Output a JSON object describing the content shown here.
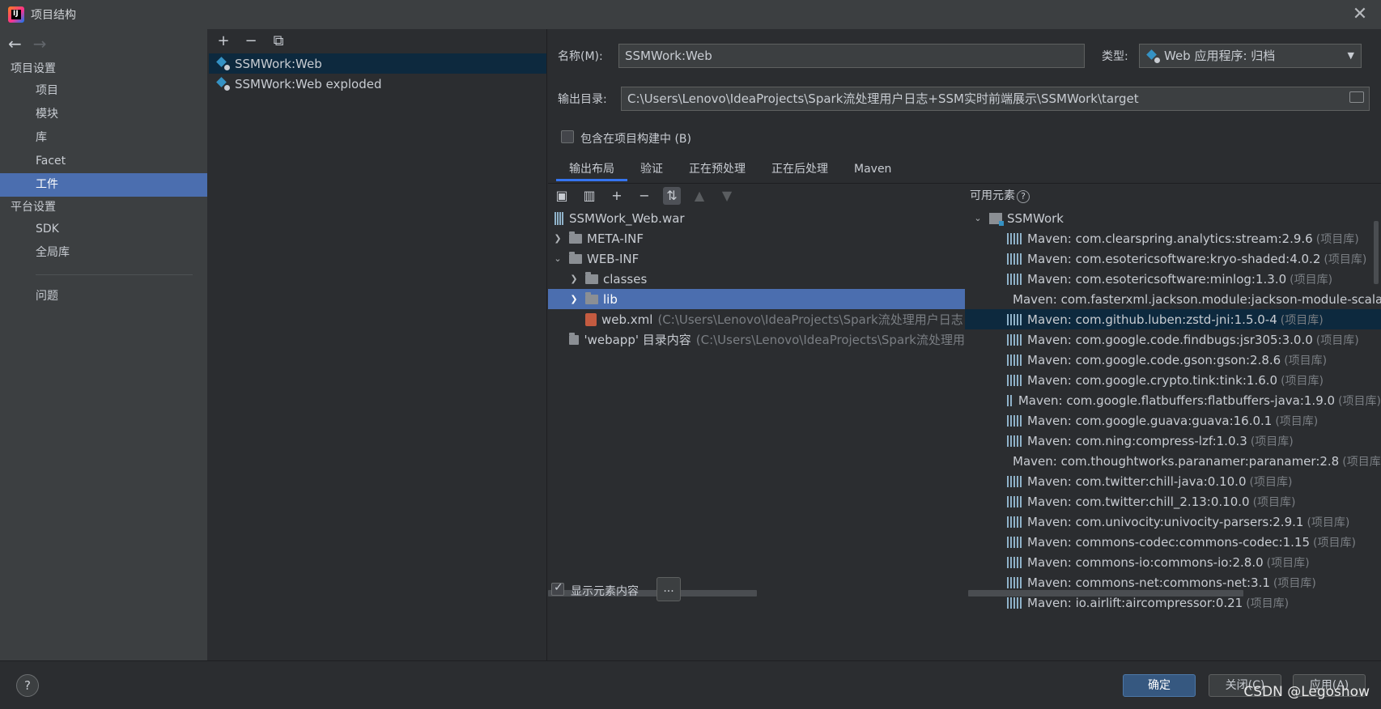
{
  "window": {
    "title": "项目结构",
    "close": "✕"
  },
  "nav": {
    "back": "←",
    "forward": "→",
    "project_settings": "项目设置",
    "project_items": [
      "项目",
      "模块",
      "库",
      "Facet",
      "工件"
    ],
    "platform_settings": "平台设置",
    "platform_items": [
      "SDK",
      "全局库"
    ],
    "problems": "问题"
  },
  "artifacts": {
    "toolbar": {
      "add": "+",
      "remove": "−",
      "copy": "⧉"
    },
    "items": [
      "SSMWork:Web",
      "SSMWork:Web exploded"
    ]
  },
  "config": {
    "name_label": "名称(M):",
    "name_value": "SSMWork:Web",
    "type_label": "类型:",
    "type_value": "Web 应用程序: 归档",
    "output_label": "输出目录:",
    "output_value": "C:\\Users\\Lenovo\\IdeaProjects\\Spark流处理用户日志+SSM实时前端展示\\SSMWork\\target",
    "include_label": "包含在项目构建中 (B)",
    "tabs": [
      "输出布局",
      "验证",
      "正在预处理",
      "正在后处理",
      "Maven"
    ],
    "show_content_label": "显示元素内容",
    "ellipsis": "..."
  },
  "layout_tree": {
    "root": "SSMWork_Web.war",
    "meta_inf": "META-INF",
    "web_inf": "WEB-INF",
    "classes": "classes",
    "lib": "lib",
    "web_xml": "web.xml",
    "web_xml_path": "(C:\\Users\\Lenovo\\IdeaProjects\\Spark流处理用户日志",
    "webapp": "'webapp' 目录内容",
    "webapp_path": "(C:\\Users\\Lenovo\\IdeaProjects\\Spark流处理用"
  },
  "available": {
    "header": "可用元素",
    "help": "?",
    "module": "SSMWork",
    "lib_tag": "(项目库)",
    "libs": [
      "Maven: com.clearspring.analytics:stream:2.9.6",
      "Maven: com.esotericsoftware:kryo-shaded:4.0.2",
      "Maven: com.esotericsoftware:minlog:1.3.0",
      "Maven: com.fasterxml.jackson.module:jackson-module-scala",
      "Maven: com.github.luben:zstd-jni:1.5.0-4",
      "Maven: com.google.code.findbugs:jsr305:3.0.0",
      "Maven: com.google.code.gson:gson:2.8.6",
      "Maven: com.google.crypto.tink:tink:1.6.0",
      "Maven: com.google.flatbuffers:flatbuffers-java:1.9.0",
      "Maven: com.google.guava:guava:16.0.1",
      "Maven: com.ning:compress-lzf:1.0.3",
      "Maven: com.thoughtworks.paranamer:paranamer:2.8",
      "Maven: com.twitter:chill-java:0.10.0",
      "Maven: com.twitter:chill_2.13:0.10.0",
      "Maven: com.univocity:univocity-parsers:2.9.1",
      "Maven: commons-codec:commons-codec:1.15",
      "Maven: commons-io:commons-io:2.8.0",
      "Maven: commons-net:commons-net:3.1",
      "Maven: io.airlift:aircompressor:0.21"
    ]
  },
  "buttons": {
    "help": "?",
    "ok": "确定",
    "close": "关闭(C)",
    "apply": "应用(A)"
  },
  "watermark": "CSDN @Legoshow"
}
